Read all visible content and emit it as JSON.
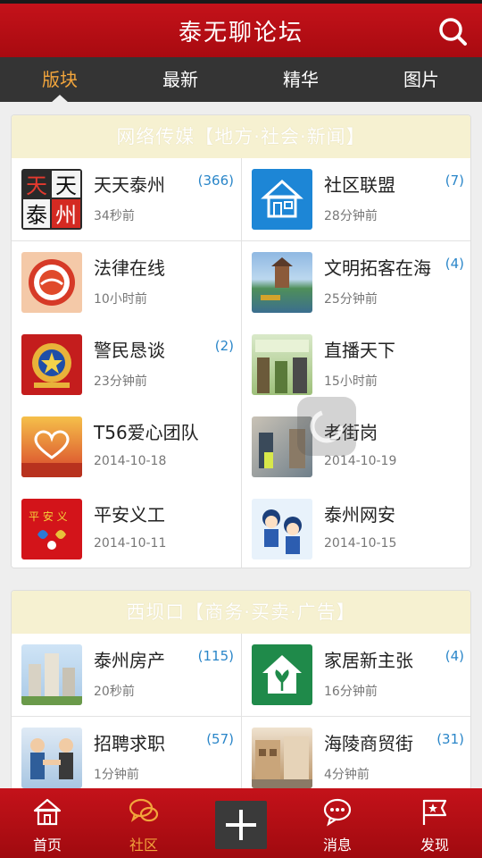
{
  "header": {
    "title": "泰无聊论坛"
  },
  "tabs": [
    {
      "label": "版块",
      "active": true
    },
    {
      "label": "最新"
    },
    {
      "label": "精华"
    },
    {
      "label": "图片"
    }
  ],
  "sections": [
    {
      "title": "网络传媒【地方·社会·新闻】",
      "items": [
        {
          "name": "天天泰州",
          "count": "(366)",
          "time": "34秒前",
          "icon": "tiantian-logo"
        },
        {
          "name": "社区联盟",
          "count": "(7)",
          "time": "28分钟前",
          "icon": "house-icon"
        },
        {
          "name": "法律在线",
          "count": "",
          "time": "10小时前",
          "icon": "law-emblem"
        },
        {
          "name": "文明拓客在海",
          "count": "(4)",
          "time": "25分钟前",
          "icon": "tower-photo"
        },
        {
          "name": "警民恳谈",
          "count": "(2)",
          "time": "23分钟前",
          "icon": "police-emblem"
        },
        {
          "name": "直播天下",
          "count": "",
          "time": "15小时前",
          "icon": "live-photo"
        },
        {
          "name": "T56爱心团队",
          "count": "",
          "time": "2014-10-18",
          "icon": "heart-hands"
        },
        {
          "name": "老街岗",
          "count": "",
          "time": "2014-10-19",
          "icon": "street-photo"
        },
        {
          "name": "平安义工",
          "count": "",
          "time": "2014-10-11",
          "icon": "volunteer-logo"
        },
        {
          "name": "泰州网安",
          "count": "",
          "time": "2014-10-15",
          "icon": "cyber-police"
        }
      ]
    },
    {
      "title": "西坝口【商务·买卖·广告】",
      "items": [
        {
          "name": "泰州房产",
          "count": "(115)",
          "time": "20秒前",
          "icon": "building-photo"
        },
        {
          "name": "家居新主张",
          "count": "(4)",
          "time": "16分钟前",
          "icon": "green-house-icon"
        },
        {
          "name": "招聘求职",
          "count": "(57)",
          "time": "1分钟前",
          "icon": "handshake-photo"
        },
        {
          "name": "海陵商贸街",
          "count": "(31)",
          "time": "4分钟前",
          "icon": "market-photo"
        }
      ]
    }
  ],
  "bottom_nav": [
    {
      "label": "首页",
      "icon": "home-icon"
    },
    {
      "label": "社区",
      "icon": "chat-bubbles-icon",
      "active": true
    },
    {
      "label": "",
      "icon": "plus-icon"
    },
    {
      "label": "消息",
      "icon": "message-icon"
    },
    {
      "label": "发现",
      "icon": "discover-icon"
    }
  ],
  "colors": {
    "brand_red": "#b80e15",
    "tab_active": "#f2a53c",
    "count_blue": "#2a86c9",
    "section_header_bg": "#f6f1d1"
  }
}
